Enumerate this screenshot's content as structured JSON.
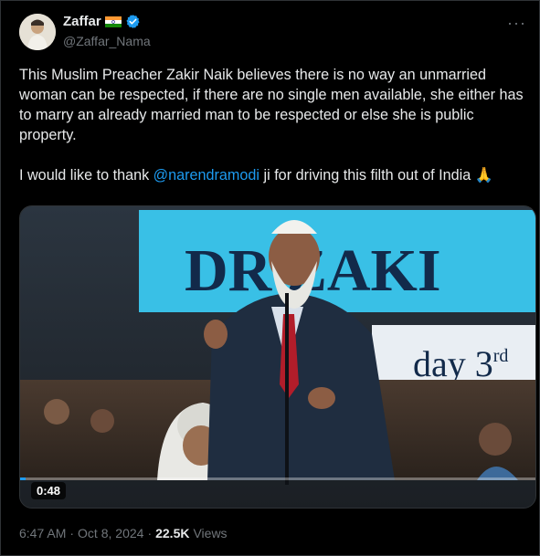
{
  "author": {
    "name": "Zaffar",
    "handle": "@Zaffar_Nama",
    "flag_icon": "india-flag-icon",
    "verified_icon": "verified-badge-icon"
  },
  "more_label": "···",
  "post": {
    "paragraph1": "This Muslim Preacher Zakir Naik believes there is no way an unmarried woman can be respected, if there are no single men available, she either has to marry an already married man to be respected or else she is public property.",
    "p2_before": "I would like to thank ",
    "p2_mention": "@narendramodi",
    "p2_after": " ji for driving this filth out of India 🙏"
  },
  "video": {
    "duration": "0:48",
    "banner_text": "DR ZAKI",
    "sub_text": "day 3",
    "sub_sup": "rd",
    "progress_fraction": 0.01
  },
  "meta": {
    "time": "6:47 AM",
    "sep": "·",
    "date": "Oct 8, 2024",
    "views_count": "22.5K",
    "views_label": "Views"
  },
  "colors": {
    "accent": "#1d9bf0",
    "background": "#000000",
    "muted": "#71767b",
    "text": "#e7e9ea"
  }
}
